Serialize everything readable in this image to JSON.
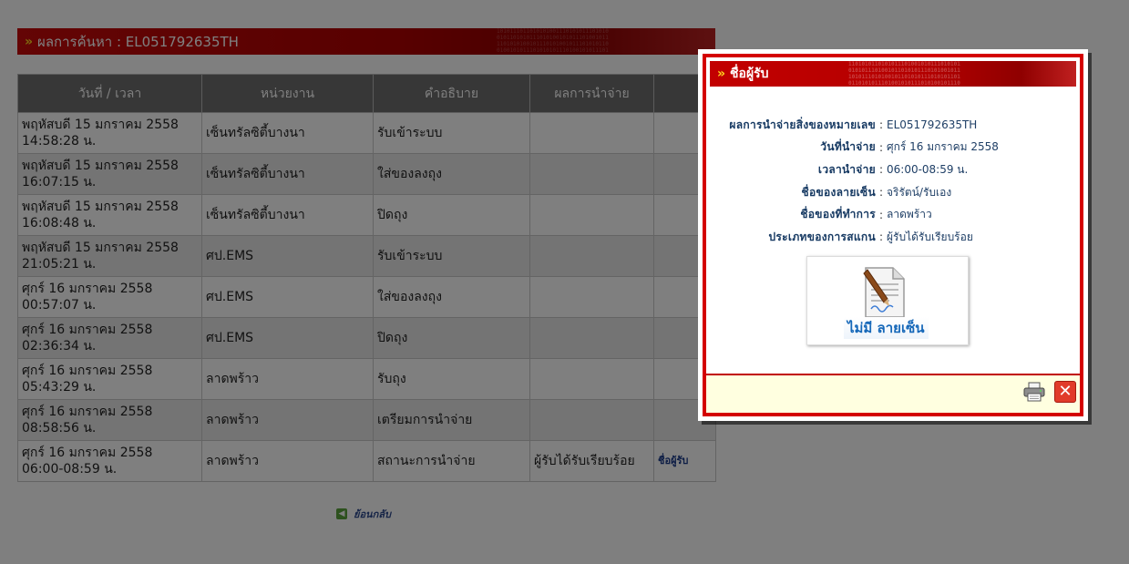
{
  "result_bar": {
    "title": "ผลการค้นหา : EL051792635TH"
  },
  "table": {
    "headers": [
      "วันที่ / เวลา",
      "หน่วยงาน",
      "คำอธิบาย",
      "ผลการนำจ่าย",
      ""
    ],
    "rows": [
      {
        "date": "พฤหัสบดี 15 มกราคม 2558",
        "time": "14:58:28 น.",
        "office": "เซ็นทรัลซิตี้บางนา",
        "desc": "รับเข้าระบบ",
        "result": "",
        "link": ""
      },
      {
        "date": "พฤหัสบดี 15 มกราคม 2558",
        "time": "16:07:15 น.",
        "office": "เซ็นทรัลซิตี้บางนา",
        "desc": "ใส่ของลงถุง",
        "result": "",
        "link": ""
      },
      {
        "date": "พฤหัสบดี 15 มกราคม 2558",
        "time": "16:08:48 น.",
        "office": "เซ็นทรัลซิตี้บางนา",
        "desc": "ปิดถุง",
        "result": "",
        "link": ""
      },
      {
        "date": "พฤหัสบดี 15 มกราคม 2558",
        "time": "21:05:21 น.",
        "office": "ศป.EMS",
        "desc": "รับเข้าระบบ",
        "result": "",
        "link": ""
      },
      {
        "date": "ศุกร์ 16 มกราคม 2558",
        "time": "00:57:07 น.",
        "office": "ศป.EMS",
        "desc": "ใส่ของลงถุง",
        "result": "",
        "link": ""
      },
      {
        "date": "ศุกร์ 16 มกราคม 2558",
        "time": "02:36:34 น.",
        "office": "ศป.EMS",
        "desc": "ปิดถุง",
        "result": "",
        "link": ""
      },
      {
        "date": "ศุกร์ 16 มกราคม 2558",
        "time": "05:43:29 น.",
        "office": "ลาดพร้าว",
        "desc": "รับถุง",
        "result": "",
        "link": ""
      },
      {
        "date": "ศุกร์ 16 มกราคม 2558",
        "time": "08:58:56 น.",
        "office": "ลาดพร้าว",
        "desc": "เตรียมการนำจ่าย",
        "result": "",
        "link": ""
      },
      {
        "date": "ศุกร์ 16 มกราคม 2558",
        "time": "06:00-08:59 น.",
        "office": "ลาดพร้าว",
        "desc": "สถานะการนำจ่าย",
        "result": "ผู้รับได้รับเรียบร้อย",
        "link": "ชื่อผู้รับ"
      }
    ]
  },
  "back_link": {
    "label": "ย้อนกลับ"
  },
  "modal": {
    "title": "ชื่อผู้รับ",
    "fields": [
      {
        "label": "ผลการนำจ่ายสิ่งของหมายเลข",
        "value": "EL051792635TH"
      },
      {
        "label": "วันที่นำจ่าย",
        "value": "ศุกร์ 16 มกราคม 2558"
      },
      {
        "label": "เวลานำจ่าย",
        "value": "06:00-08:59 น."
      },
      {
        "label": "ชื่อของลายเซ็น",
        "value": "จริรัตน์/รับเอง"
      },
      {
        "label": "ชื่อของที่ทำการ",
        "value": "ลาดพร้าว"
      },
      {
        "label": "ประเภทของการสแกน",
        "value": "ผู้รับได้รับเรียบร้อย"
      }
    ],
    "separator": ":",
    "signature_text": "ไม่มี ลายเซ็น",
    "colors": {
      "frame": "#d40000",
      "footer_bg": "#ffffe0",
      "header_accent": "#ffd21e"
    }
  },
  "icons": {
    "chevron": "»",
    "close": "✕",
    "back": "◀"
  }
}
